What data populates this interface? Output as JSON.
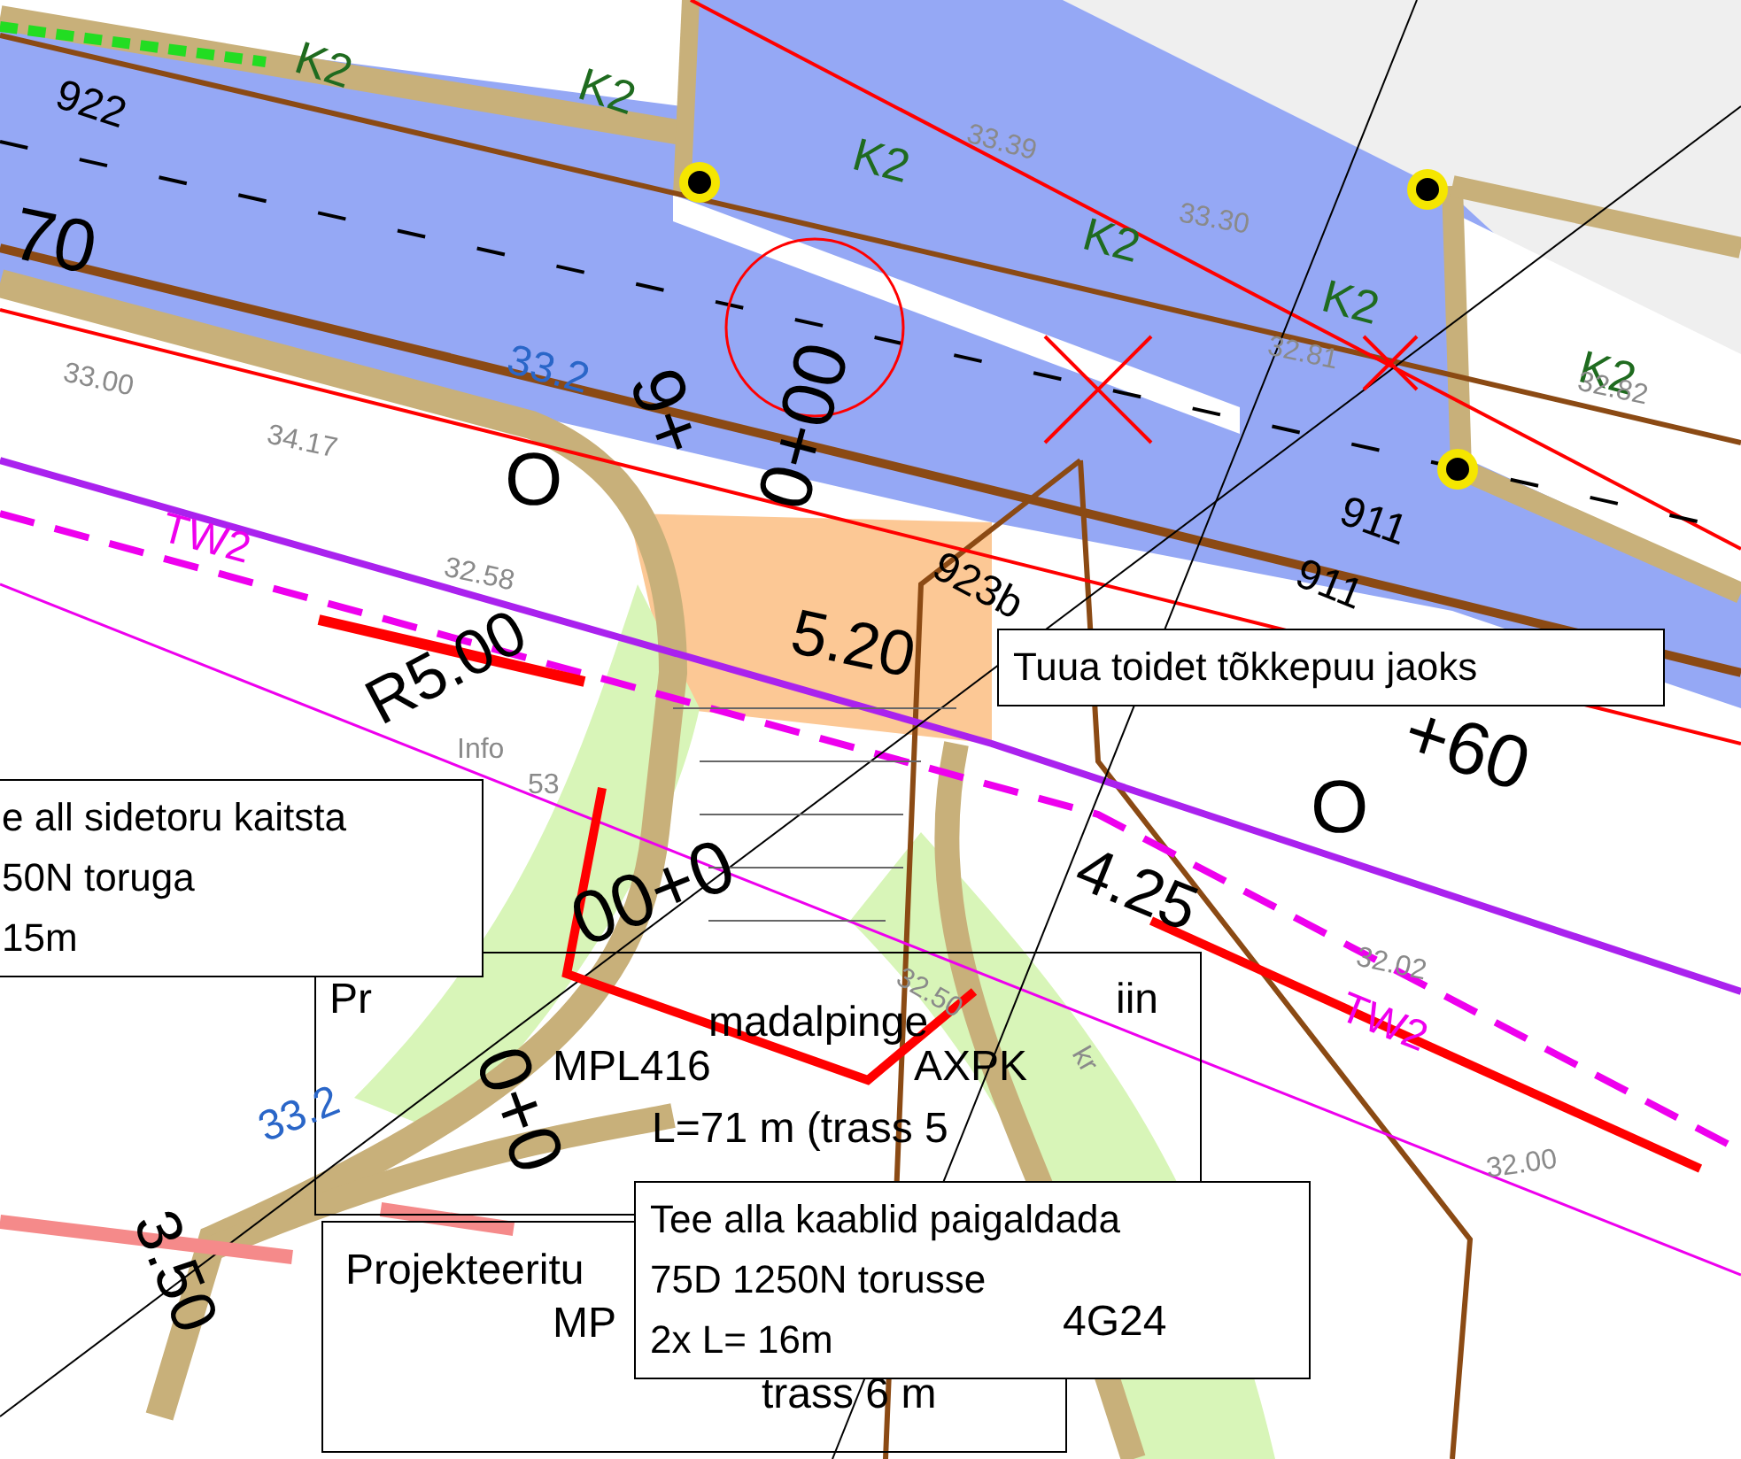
{
  "callouts": [
    {
      "lines": [
        "Tuua toidet tõkkepuu jaoks"
      ]
    },
    {
      "lines": [
        "e all sidetoru kaitsta",
        "50N toruga",
        "15m"
      ]
    },
    {
      "lines": [
        "Tee alla kaablid paigaldada",
        "75D 1250N torusse",
        "2x L= 16m"
      ]
    }
  ],
  "labels": [
    {
      "text": "922",
      "kind": "pipe"
    },
    {
      "text": "70",
      "kind": "station"
    },
    {
      "text": "K2",
      "kind": "cable"
    },
    {
      "text": "K2",
      "kind": "cable"
    },
    {
      "text": "K2",
      "kind": "cable"
    },
    {
      "text": "K2",
      "kind": "cable"
    },
    {
      "text": "K2",
      "kind": "cable"
    },
    {
      "text": "K2",
      "kind": "cable"
    },
    {
      "text": "0+00",
      "kind": "station"
    },
    {
      "text": "9+",
      "kind": "station"
    },
    {
      "text": "O",
      "kind": "station"
    },
    {
      "text": "O",
      "kind": "station"
    },
    {
      "text": "+60",
      "kind": "station"
    },
    {
      "text": "00+0",
      "kind": "station"
    },
    {
      "text": "0+0",
      "kind": "station"
    },
    {
      "text": "R5.00",
      "kind": "dimension"
    },
    {
      "text": "5.20",
      "kind": "dimension"
    },
    {
      "text": "4.25",
      "kind": "dimension"
    },
    {
      "text": "3.50",
      "kind": "dimension"
    },
    {
      "text": "TW2",
      "kind": "water"
    },
    {
      "text": "TW2",
      "kind": "water"
    },
    {
      "text": "911",
      "kind": "pipe"
    },
    {
      "text": "911",
      "kind": "pipe"
    },
    {
      "text": "923b",
      "kind": "pipe"
    },
    {
      "text": "33.2",
      "kind": "contour"
    },
    {
      "text": "33.2",
      "kind": "contour"
    },
    {
      "text": "33.39",
      "kind": "elevation"
    },
    {
      "text": "33.30",
      "kind": "elevation"
    },
    {
      "text": "32.81",
      "kind": "elevation"
    },
    {
      "text": "32.82",
      "kind": "elevation"
    },
    {
      "text": "32.58",
      "kind": "elevation"
    },
    {
      "text": "34.17",
      "kind": "elevation"
    },
    {
      "text": "33.00",
      "kind": "elevation"
    },
    {
      "text": "32.00",
      "kind": "elevation"
    },
    {
      "text": "32.02",
      "kind": "elevation"
    },
    {
      "text": "32.50",
      "kind": "elevation"
    },
    {
      "text": "Info",
      "kind": "elevation"
    },
    {
      "text": "53",
      "kind": "elevation"
    },
    {
      "text": "kr",
      "kind": "elevation"
    }
  ],
  "background_notes": [
    {
      "text": "Pr"
    },
    {
      "text": "madalpinge"
    },
    {
      "text": "iin"
    },
    {
      "text": "MPL416"
    },
    {
      "text": "AXPK"
    },
    {
      "text": "L=71 m (trass 5"
    },
    {
      "text": "Projekteeritu"
    },
    {
      "text": "MP"
    },
    {
      "text": "4G24"
    },
    {
      "text": "trass 6 m"
    }
  ]
}
